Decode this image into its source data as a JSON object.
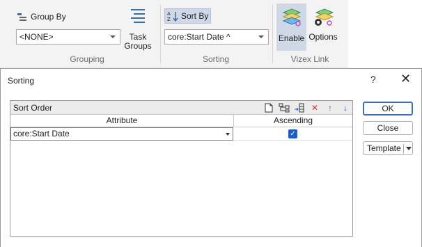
{
  "ribbon": {
    "group_by_label": "Group By",
    "group_by_value": "<NONE>",
    "task_groups_label1": "Task",
    "task_groups_label2": "Groups",
    "grouping_group_label": "Grouping",
    "sort_by_label": "Sort By",
    "sort_by_value": "core:Start Date ^",
    "sorting_group_label": "Sorting",
    "enable_label": "Enable",
    "options_label": "Options",
    "vizex_group_label": "Vizex Link"
  },
  "dialog": {
    "title": "Sorting",
    "help": "?",
    "close": "✕",
    "panel_title": "Sort Order",
    "columns": [
      "Attribute",
      "Ascending"
    ],
    "rows": [
      {
        "attribute": "core:Start Date",
        "ascending": true
      }
    ],
    "buttons": {
      "ok": "OK",
      "close": "Close",
      "template": "Template"
    }
  },
  "colors": {
    "accent": "#1f5fbf",
    "ribbon_bg": "#f3f3f3",
    "active_bg": "#cfd8e6"
  }
}
